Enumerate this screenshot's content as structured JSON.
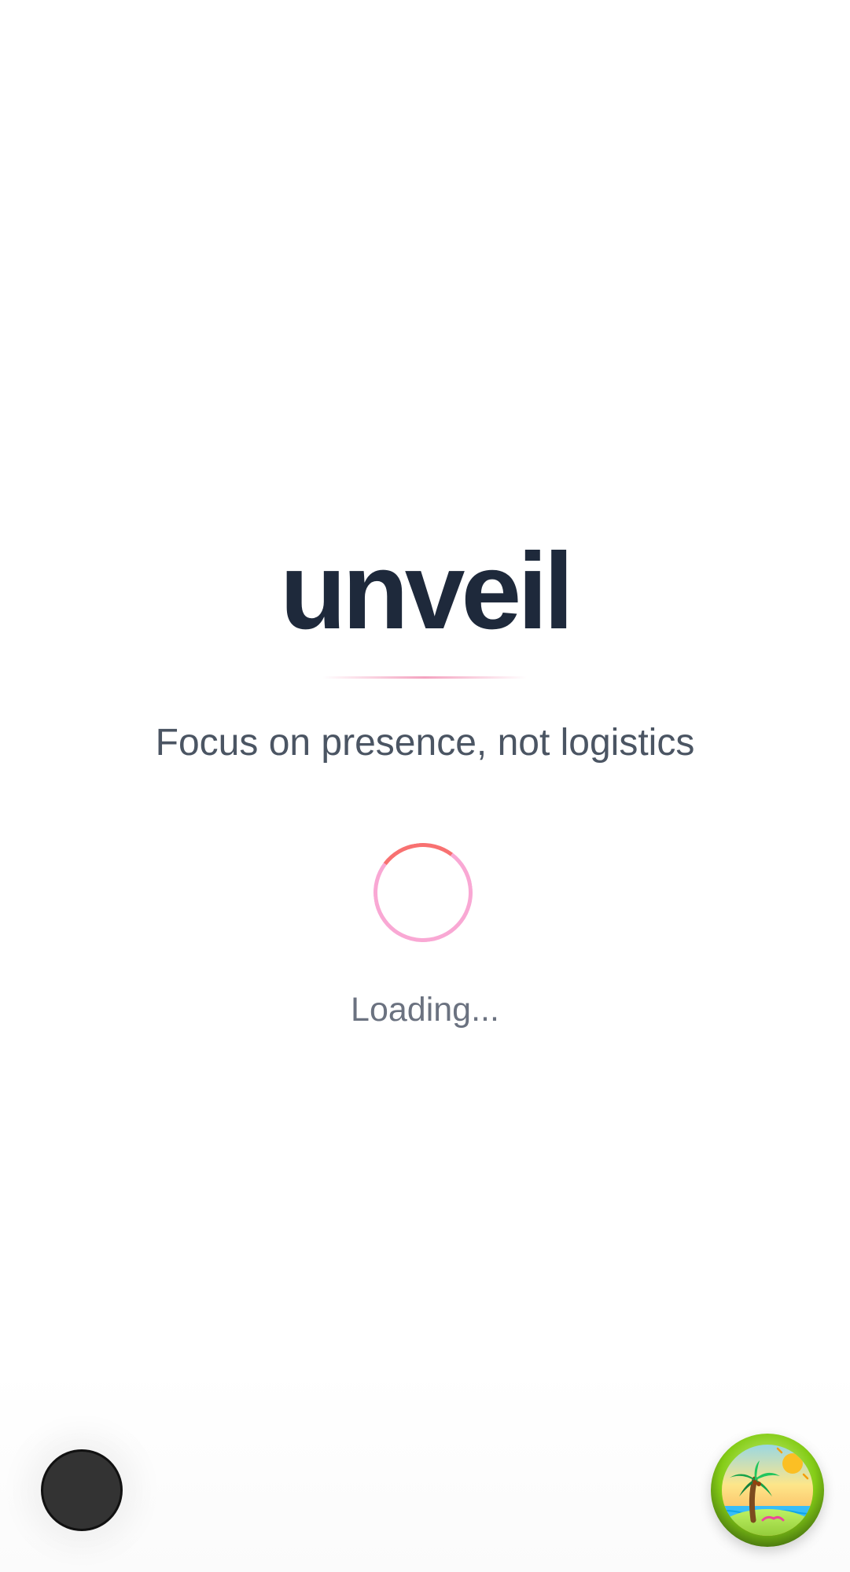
{
  "app": {
    "title": "unveil",
    "tagline": "Focus on presence, not logistics"
  },
  "loader": {
    "text": "Loading...",
    "spinner_colors": {
      "track": "#f9a8d4",
      "arc": "#f87171"
    }
  },
  "buttons": {
    "left_fab": {
      "icon": "dark-circle-icon",
      "color": "#333333"
    },
    "right_fab": {
      "icon": "tropical-island-icon"
    }
  },
  "colors": {
    "title": "#1e293b",
    "tagline": "#4b5563",
    "loading": "#6b7280",
    "divider": "#f4a3c0",
    "background": "#ffffff"
  }
}
